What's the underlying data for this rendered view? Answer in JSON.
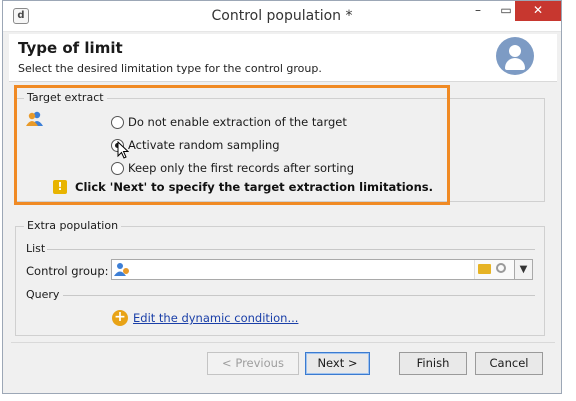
{
  "window": {
    "title": "Control population *",
    "app_icon_letter": "d",
    "minimize_glyph": "–",
    "maximize_glyph": "▭",
    "close_glyph": "✕"
  },
  "header": {
    "title": "Type of limit",
    "subtitle": "Select the desired limitation type for the control group."
  },
  "target_extract": {
    "legend": "Target extract",
    "options": [
      {
        "label": "Do not enable extraction of the target",
        "checked": false
      },
      {
        "label": "Activate random sampling",
        "checked": true
      },
      {
        "label": "Keep only the first records after sorting",
        "checked": false
      }
    ],
    "warning": "Click 'Next' to specify the target extraction limitations."
  },
  "extra_population": {
    "legend": "Extra population",
    "list_label": "List",
    "control_group_label": "Control group:",
    "control_group_value": "",
    "query_label": "Query",
    "edit_link": "Edit the dynamic condition..."
  },
  "buttons": {
    "previous": "< Previous",
    "next": "Next >",
    "finish": "Finish",
    "cancel": "Cancel"
  },
  "colors": {
    "highlight": "#f08a24",
    "link": "#1a3fa8",
    "close_button": "#c7372f",
    "avatar": "#7d9bc4"
  }
}
